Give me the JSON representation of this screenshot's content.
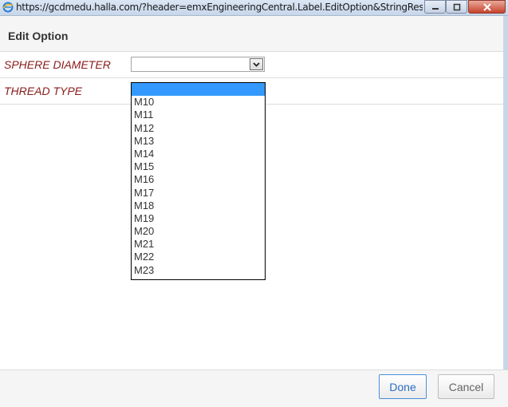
{
  "window": {
    "url": "https://gcdmedu.halla.com/?header=emxEngineeringCentral.Label.EditOption&StringResourc..."
  },
  "header": {
    "title": "Edit Option"
  },
  "form": {
    "rows": [
      {
        "label": "SPHERE DIAMETER",
        "value": ""
      },
      {
        "label": "THREAD TYPE",
        "value": ""
      }
    ]
  },
  "dropdown": {
    "options": [
      "",
      "M10",
      "M11",
      "M12",
      "M13",
      "M14",
      "M15",
      "M16",
      "M17",
      "M18",
      "M19",
      "M20",
      "M21",
      "M22",
      "M23"
    ],
    "selected_index": 0
  },
  "footer": {
    "done_label": "Done",
    "cancel_label": "Cancel"
  },
  "colors": {
    "label": "#8b1a1a",
    "selection": "#3399ff",
    "primary_button": "#2a6fc2"
  }
}
